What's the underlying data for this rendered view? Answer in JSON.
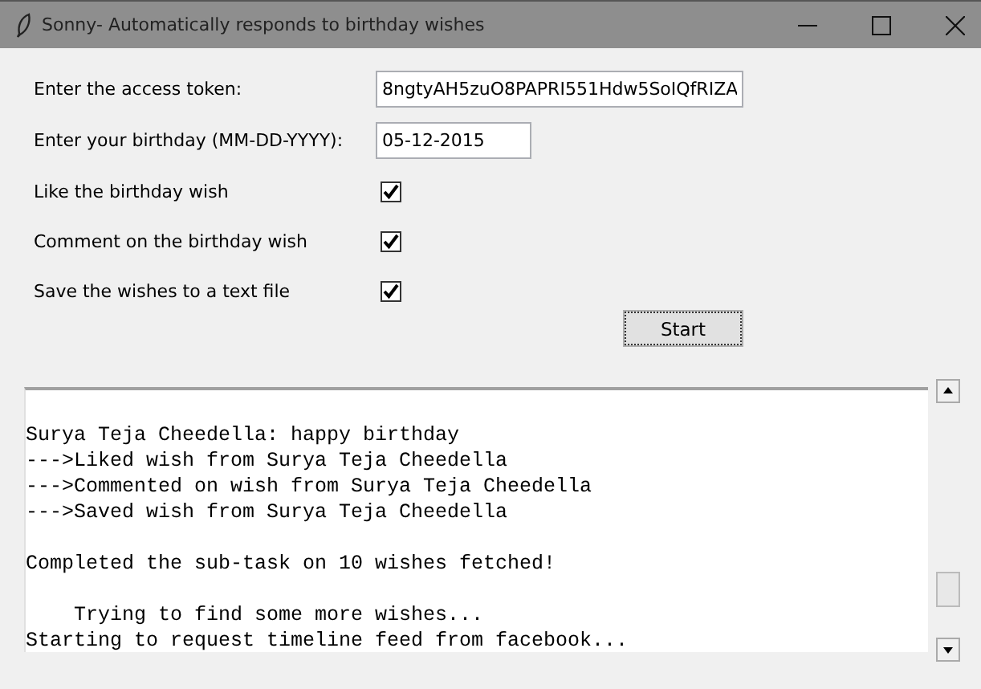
{
  "window": {
    "title": "Sonny- Automatically responds to birthday wishes"
  },
  "fields": [
    {
      "label": "Enter the access token:",
      "value": "8ngtyAH5zuO8PAPRI551Hdw5SoIQfRIZA",
      "kind": "wide"
    },
    {
      "label": "Enter your birthday (MM-DD-YYYY):",
      "value": "05-12-2015",
      "kind": "narrow"
    }
  ],
  "options": [
    {
      "label": "Like the birthday wish",
      "checked": true
    },
    {
      "label": "Comment on the birthday wish",
      "checked": true
    },
    {
      "label": "Save the wishes to a text file",
      "checked": true
    }
  ],
  "start_button": {
    "label": "Start"
  },
  "log": [
    {
      "lines": [
        "Surya Teja Cheedella: happy birthday",
        "--->Liked wish from Surya Teja Cheedella",
        "--->Commented on wish from Surya Teja Cheedella",
        "--->Saved wish from Surya Teja Cheedella"
      ]
    },
    {
      "lines": [
        "Completed the sub-task on 10 wishes fetched!"
      ]
    },
    {
      "lines": [
        "    Trying to find some more wishes...",
        "Starting to request timeline feed from facebook..."
      ]
    }
  ]
}
